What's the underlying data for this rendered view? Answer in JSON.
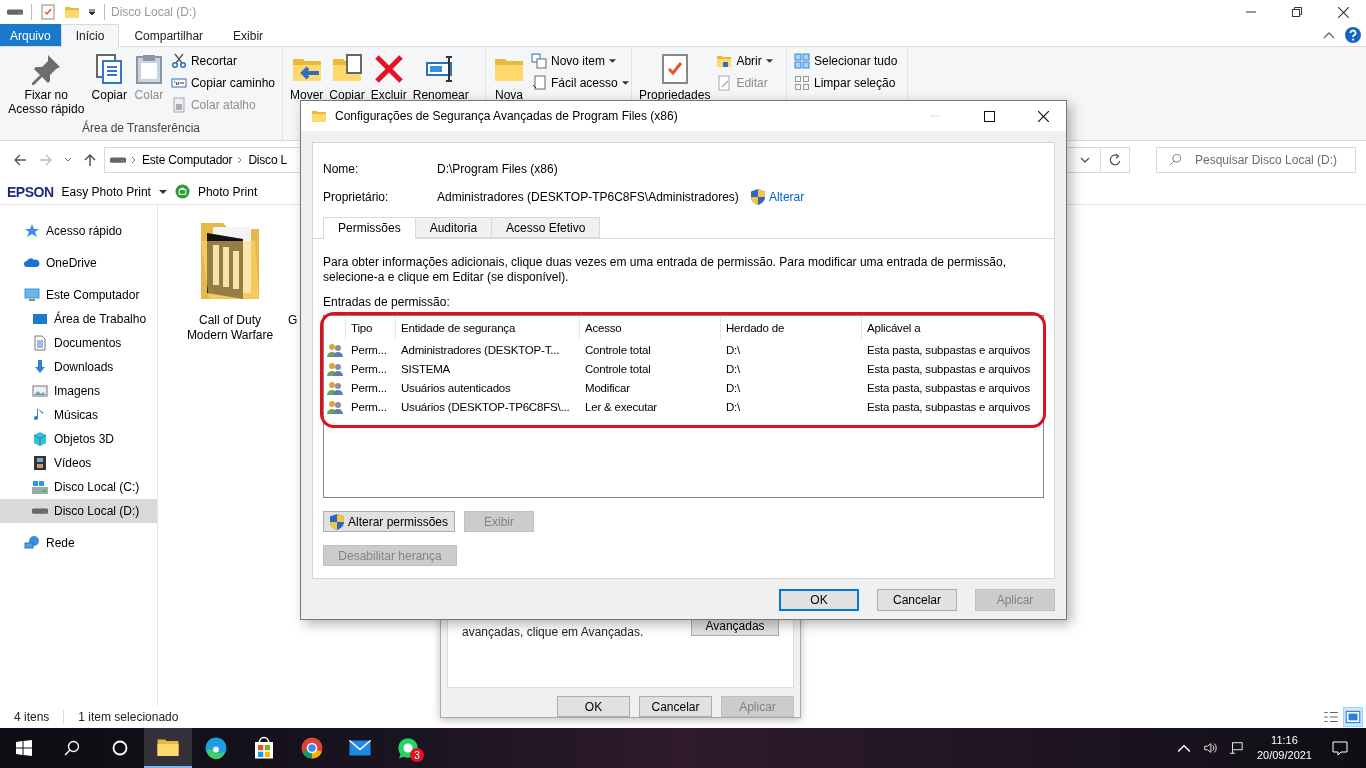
{
  "explorer": {
    "title": "Disco Local (D:)",
    "ribbon_tabs": [
      {
        "label": "Arquivo",
        "kind": "file",
        "selected": false
      },
      {
        "label": "Início",
        "kind": "tab",
        "selected": true
      },
      {
        "label": "Compartilhar",
        "kind": "tab",
        "selected": false
      },
      {
        "label": "Exibir",
        "kind": "tab",
        "selected": false
      }
    ],
    "ribbon_groups": [
      {
        "label": "Área de Transferência",
        "large": [
          {
            "label": "Fixar no Acesso rápido",
            "disabled": false
          },
          {
            "label": "Copiar",
            "disabled": false
          },
          {
            "label": "Colar",
            "disabled": true
          }
        ],
        "small": [
          {
            "label": "Recortar",
            "disabled": false,
            "dropdown": false
          },
          {
            "label": "Copiar caminho",
            "disabled": false,
            "dropdown": false
          },
          {
            "label": "Colar atalho",
            "disabled": true,
            "dropdown": false
          }
        ]
      },
      {
        "large": [
          {
            "label": "Mover",
            "disabled": false
          },
          {
            "label": "Copiar",
            "disabled": false
          },
          {
            "label": "Excluir",
            "disabled": false
          },
          {
            "label": "Renomear",
            "disabled": false
          }
        ]
      },
      {
        "large": [
          {
            "label": "Nova",
            "disabled": false
          }
        ],
        "small": [
          {
            "label": "Novo item",
            "disabled": false,
            "dropdown": true
          },
          {
            "label": "Fácil acesso",
            "disabled": false,
            "dropdown": true
          }
        ]
      },
      {
        "large": [
          {
            "label": "Propriedades",
            "disabled": false
          }
        ],
        "small": [
          {
            "label": "Abrir",
            "disabled": false,
            "dropdown": true
          },
          {
            "label": "Editar",
            "disabled": true,
            "dropdown": false
          }
        ]
      },
      {
        "small": [
          {
            "label": "Selecionar tudo",
            "disabled": false,
            "dropdown": false
          },
          {
            "label": "Limpar seleção",
            "disabled": false,
            "dropdown": false
          }
        ]
      }
    ],
    "breadcrumb": [
      "Este Computador",
      "Disco L"
    ],
    "search": {
      "placeholder": "Pesquisar Disco Local (D:)"
    },
    "epson": {
      "brand": "EPSON",
      "apps": [
        {
          "label": "Easy Photo Print",
          "dropdown": true
        },
        {
          "label": "Photo Print",
          "dropdown": false
        }
      ]
    },
    "nav": [
      {
        "label": "Acesso rápido",
        "selected": false
      },
      {
        "label": "OneDrive",
        "selected": false
      },
      {
        "label": "Este Computador",
        "selected": false,
        "children": [
          {
            "label": "Área de Trabalho",
            "selected": false
          },
          {
            "label": "Documentos",
            "selected": false
          },
          {
            "label": "Downloads",
            "selected": false
          },
          {
            "label": "Imagens",
            "selected": false
          },
          {
            "label": "Músicas",
            "selected": false
          },
          {
            "label": "Objetos 3D",
            "selected": false
          },
          {
            "label": "Vídeos",
            "selected": false
          },
          {
            "label": "Disco Local (C:)",
            "selected": false
          },
          {
            "label": "Disco Local (D:)",
            "selected": true
          }
        ]
      },
      {
        "label": "Rede",
        "selected": false
      }
    ],
    "files": [
      {
        "name": "Call of Duty Modern Warfare",
        "kind": "folder"
      },
      {
        "name": "G",
        "kind": "partial"
      }
    ],
    "status": {
      "count": "4 itens",
      "selection": "1 item selecionado"
    },
    "views": [
      {
        "kind": "details",
        "selected": false
      },
      {
        "kind": "thumbnails",
        "selected": true
      }
    ]
  },
  "advanced": {
    "title": "Configurações de Segurança Avançadas de Program Files (x86)",
    "window_controls": [
      {
        "kind": "minimize",
        "disabled": true
      },
      {
        "kind": "maximize",
        "disabled": false
      },
      {
        "kind": "close",
        "disabled": false
      }
    ],
    "name_label": "Nome:",
    "name_value": "D:\\Program Files (x86)",
    "owner_label": "Proprietário:",
    "owner_value": "Administradores (DESKTOP-TP6C8FS\\Administradores)",
    "change_link": "Alterar",
    "tabs": [
      {
        "label": "Permissões",
        "selected": true
      },
      {
        "label": "Auditoria",
        "selected": false
      },
      {
        "label": "Acesso Efetivo",
        "selected": false
      }
    ],
    "description": "Para obter informações adicionais, clique duas vezes em uma entrada de permissão. Para modificar uma entrada de permissão, selecione-a e clique em Editar (se disponível).",
    "entries_label": "Entradas de permissão:",
    "columns": [
      "Tipo",
      "Entidade de segurança",
      "Acesso",
      "Herdado de",
      "Aplicável a"
    ],
    "rows": [
      {
        "type": "Perm...",
        "principal": "Administradores (DESKTOP-T...",
        "access": "Controle total",
        "inherited_from": "D:\\",
        "applies_to": "Esta pasta, subpastas e arquivos"
      },
      {
        "type": "Perm...",
        "principal": "SISTEMA",
        "access": "Controle total",
        "inherited_from": "D:\\",
        "applies_to": "Esta pasta, subpastas e arquivos"
      },
      {
        "type": "Perm...",
        "principal": "Usuários autenticados",
        "access": "Modificar",
        "inherited_from": "D:\\",
        "applies_to": "Esta pasta, subpastas e arquivos"
      },
      {
        "type": "Perm...",
        "principal": "Usuários (DESKTOP-TP6C8FS\\...",
        "access": "Ler & executar",
        "inherited_from": "D:\\",
        "applies_to": "Esta pasta, subpastas e arquivos"
      }
    ],
    "actions": [
      {
        "label": "Alterar permissões",
        "disabled": false,
        "shield": true
      },
      {
        "label": "Exibir",
        "disabled": true,
        "shield": false
      }
    ],
    "inheritance_button": {
      "label": "Desabilitar herança",
      "disabled": true
    },
    "footer": [
      {
        "label": "OK",
        "disabled": false,
        "default": true
      },
      {
        "label": "Cancelar",
        "disabled": false,
        "default": false
      },
      {
        "label": "Aplicar",
        "disabled": true,
        "default": false
      }
    ]
  },
  "properties": {
    "hint": "avançadas, clique em Avançadas.",
    "advanced_button": "Avançadas",
    "footer": [
      {
        "label": "OK",
        "disabled": false
      },
      {
        "label": "Cancelar",
        "disabled": false
      },
      {
        "label": "Aplicar",
        "disabled": true
      }
    ]
  },
  "taskbar": {
    "apps": [
      {
        "kind": "explorer",
        "selected": true
      },
      {
        "kind": "edge",
        "selected": false
      },
      {
        "kind": "store",
        "selected": false
      },
      {
        "kind": "chrome",
        "selected": false
      },
      {
        "kind": "mail",
        "selected": false
      },
      {
        "kind": "whatsapp",
        "selected": false,
        "badge": "3"
      }
    ],
    "time": "11:16",
    "date": "20/09/2021"
  }
}
